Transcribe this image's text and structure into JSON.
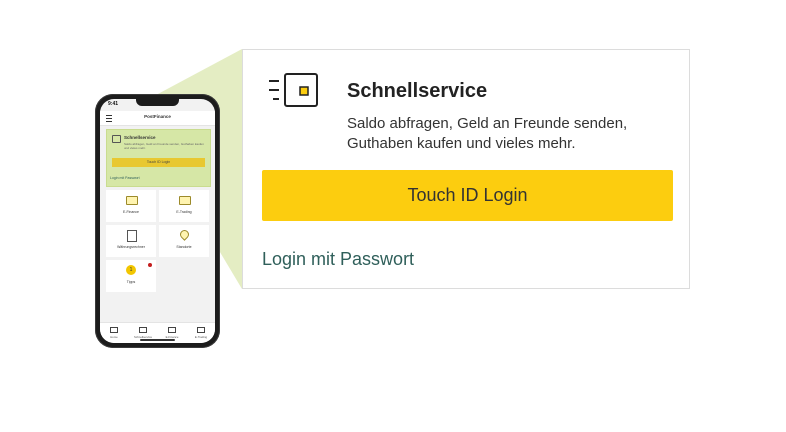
{
  "colors": {
    "accent_yellow": "#fccd0f",
    "highlight_green": "#d6e7a6",
    "link_teal": "#2f5f5a",
    "notification_red": "#c41e1e"
  },
  "phone": {
    "status_time": "9:41",
    "app_title": "PostFinance",
    "quick_card": {
      "title": "Schnellservice",
      "text": "Saldo abfragen, Geld an Freunde senden, Guthaben kaufen und vieles mehr.",
      "touch_label": "Touch ID Login",
      "password_label": "Login mit Passwort"
    },
    "tiles": [
      {
        "label": "E-Finance"
      },
      {
        "label": "E-Trading"
      },
      {
        "label": "Währungsrechner"
      },
      {
        "label": "Standorte"
      },
      {
        "label": "Tipps",
        "badge_number": "1"
      }
    ],
    "tabs": [
      {
        "label": "Home"
      },
      {
        "label": "Schnellservice"
      },
      {
        "label": "E-Finance"
      },
      {
        "label": "E-Trading"
      }
    ]
  },
  "card": {
    "icon": "wallet-speed-icon",
    "title": "Schnellservice",
    "subtitle": "Saldo abfragen, Geld an Freunde senden, Guthaben kaufen und vieles mehr.",
    "touch_button_label": "Touch ID Login",
    "password_link_label": "Login mit Passwort"
  }
}
